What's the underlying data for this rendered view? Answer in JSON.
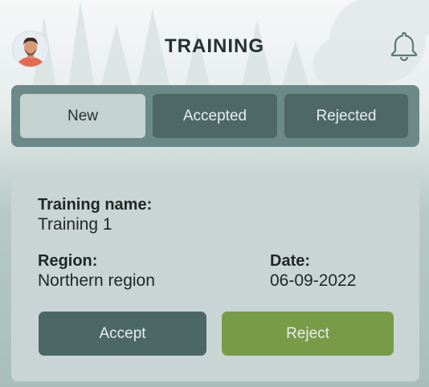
{
  "header": {
    "title": "TRAINING",
    "avatar_icon": "user-avatar",
    "notification_icon": "bell-icon"
  },
  "tabs": [
    {
      "label": "New",
      "active": true
    },
    {
      "label": "Accepted",
      "active": false
    },
    {
      "label": "Rejected",
      "active": false
    }
  ],
  "training": {
    "name_label": "Training name:",
    "name_value": "Training 1",
    "region_label": "Region:",
    "region_value": "Northern region",
    "date_label": "Date:",
    "date_value": "06-09-2022"
  },
  "actions": {
    "accept_label": "Accept",
    "reject_label": "Reject"
  },
  "colors": {
    "tab_bar": "#6b8a87",
    "tab_inactive": "#4d6865",
    "tab_active": "#c4d3d1",
    "accept_button": "#4b6865",
    "reject_button": "#789b47",
    "card_background": "#c9d5d4"
  }
}
